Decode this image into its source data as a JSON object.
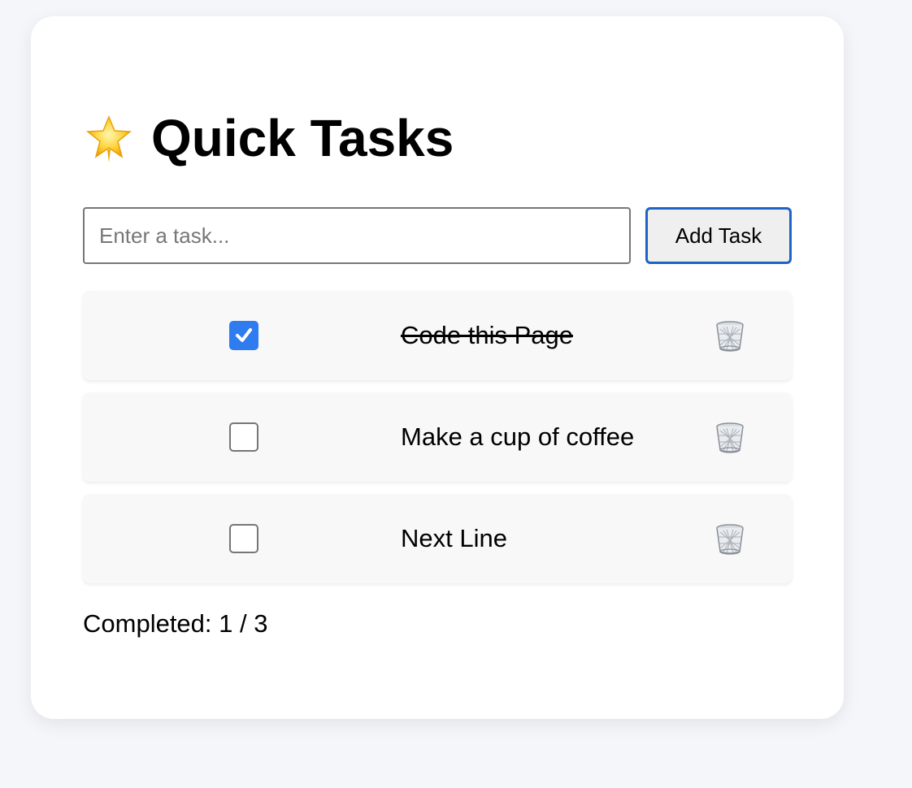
{
  "header": {
    "title": "Quick Tasks",
    "icon": "star-icon"
  },
  "form": {
    "input_value": "",
    "input_placeholder": "Enter a task...",
    "add_button_label": "Add Task"
  },
  "tasks": [
    {
      "text": "Code this Page",
      "completed": true
    },
    {
      "text": "Make a cup of coffee",
      "completed": false
    },
    {
      "text": "Next Line",
      "completed": false
    }
  ],
  "summary": {
    "completed_text": "Completed: 1 / 3"
  },
  "colors": {
    "accent": "#2f7bf0",
    "button_border": "#1f63c6",
    "page_bg": "#f5f6f9"
  }
}
